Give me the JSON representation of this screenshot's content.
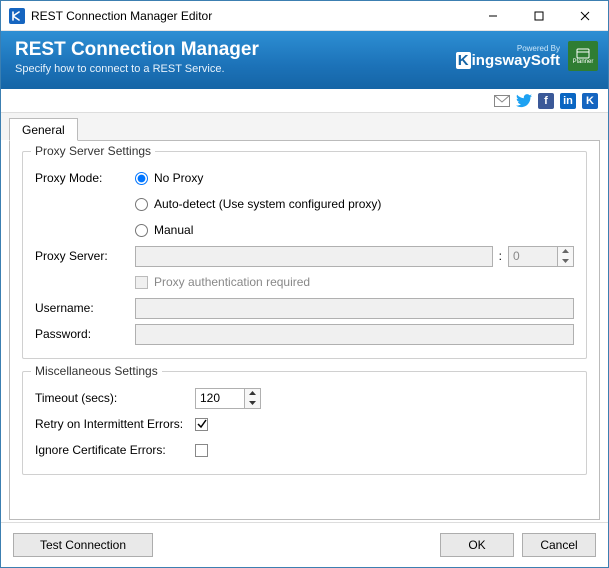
{
  "window": {
    "title": "REST Connection Manager Editor"
  },
  "banner": {
    "headline": "REST Connection Manager",
    "subtitle": "Specify how to connect to a REST Service.",
    "powered_by": "Powered By",
    "brand_leading": "K",
    "brand_rest": "ingswaySoft",
    "planner_label": "Planner"
  },
  "tabs": {
    "general": "General"
  },
  "proxy": {
    "legend": "Proxy Server Settings",
    "mode_label": "Proxy Mode:",
    "options": {
      "no_proxy": "No Proxy",
      "auto": "Auto-detect (Use system configured proxy)",
      "manual": "Manual"
    },
    "server_label": "Proxy Server:",
    "port_value": "0",
    "auth_required_label": "Proxy authentication required",
    "username_label": "Username:",
    "password_label": "Password:"
  },
  "misc": {
    "legend": "Miscellaneous Settings",
    "timeout_label": "Timeout (secs):",
    "timeout_value": "120",
    "retry_label": "Retry on Intermittent Errors:",
    "ignore_cert_label": "Ignore Certificate Errors:"
  },
  "buttons": {
    "test": "Test Connection",
    "ok": "OK",
    "cancel": "Cancel"
  }
}
